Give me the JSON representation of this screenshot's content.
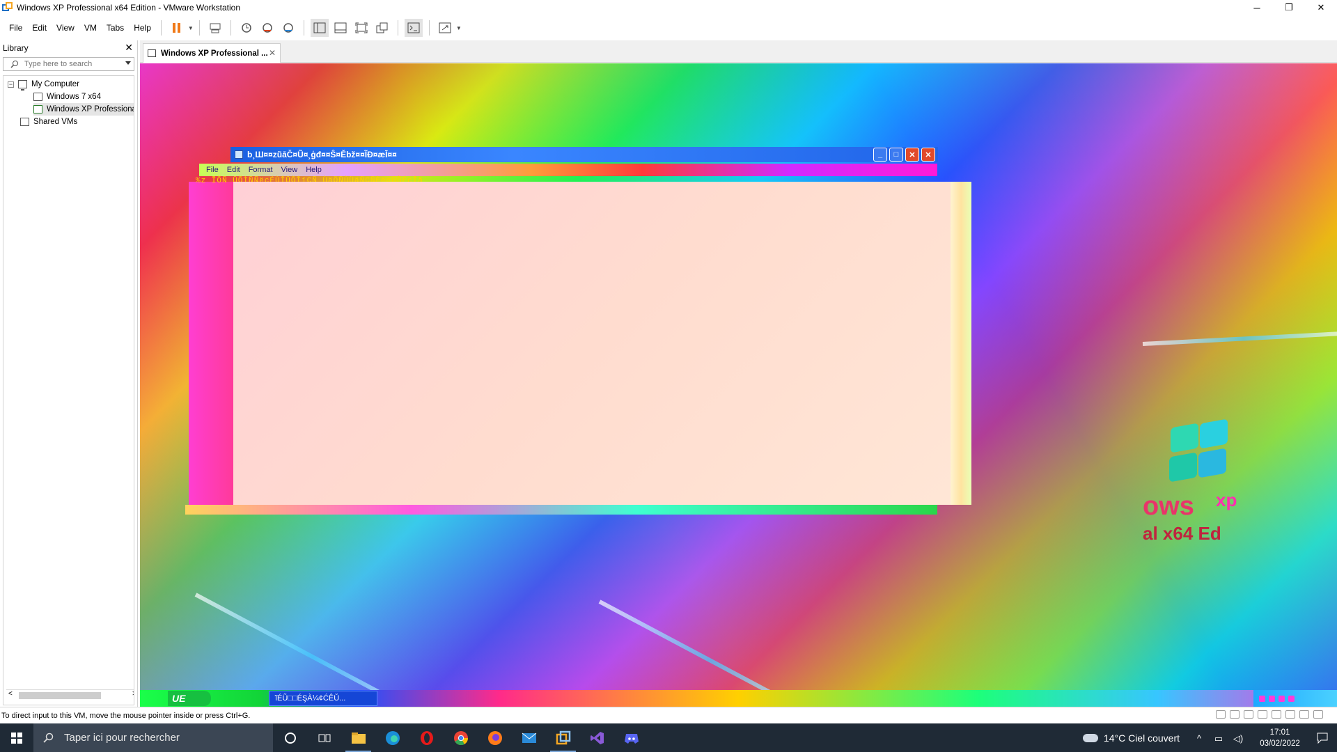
{
  "window": {
    "title": "Windows XP Professional x64 Edition - VMware Workstation",
    "min": "─",
    "restore": "❐",
    "close": "✕"
  },
  "menu": [
    "File",
    "Edit",
    "View",
    "VM",
    "Tabs",
    "Help"
  ],
  "toolbar": {
    "icons": [
      "pause-icon",
      "send-keys-icon",
      "snapshot-icon",
      "revert-snapshot-icon",
      "snapshot-manager-icon",
      "library-view-icon",
      "thumbnail-view-icon",
      "fullscreen-icon",
      "unity-icon",
      "console-icon",
      "stretch-icon"
    ]
  },
  "library": {
    "header": "Library",
    "close": "✕",
    "search_placeholder": "Type here to search",
    "tree": {
      "my_computer": "My Computer",
      "expander": "−",
      "vm1": "Windows 7 x64",
      "vm2": "Windows XP Professiona",
      "shared": "Shared VMs"
    },
    "scroll_left": "<",
    "scroll_right": ">"
  },
  "tab": {
    "label": "Windows XP Professional ...",
    "close": "✕"
  },
  "guest": {
    "notepad_title": "b¸Ш¤¤zũāČ¤Ũ¤¸ģđ¤¤Ŝ¤Ěbž¤¤ĨĐ¤æĪ¤¤",
    "notepad_menu": [
      "File",
      "Edit",
      "Format",
      "View",
      "Help"
    ],
    "garbled_line": "%z ĨÕÑ ÜÕÌÑÑëçÉÙÎÜÕÎïÇÑ ÙäÖÑÙÜäÑÇÑÈëçÜÕÉçÎä",
    "xp_word": "ows",
    "xp_sup": "xp",
    "xp_sub": "al x64 Ed",
    "start_label": "UE",
    "task_label": "ĩÉŨ□□ÉŞÀ¼¢ĆÊŬ..."
  },
  "status": {
    "message": "To direct input to this VM, move the mouse pointer inside or press Ctrl+G."
  },
  "taskbar": {
    "search_placeholder": "Taper ici pour rechercher",
    "apps": [
      "cortana-icon",
      "task-view-icon",
      "file-explorer-icon",
      "edge-icon",
      "opera-icon",
      "chrome-icon",
      "firefox-icon",
      "mail-icon",
      "vmware-icon",
      "visual-studio-icon",
      "discord-icon"
    ],
    "weather": "14°C  Ciel couvert",
    "time": "17:01",
    "date": "03/02/2022"
  }
}
